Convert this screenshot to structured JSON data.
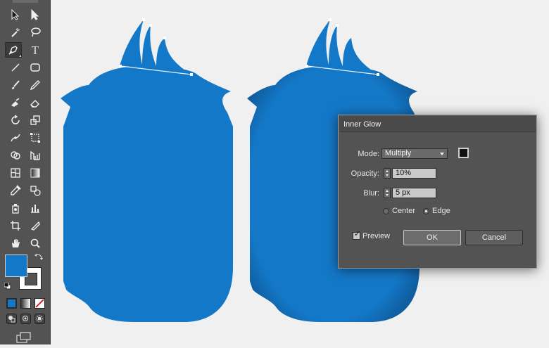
{
  "toolbar": {
    "type_tool_glyph": "T",
    "tools": [
      {
        "name": "selection-tool-icon"
      },
      {
        "name": "direct-selection-tool-icon"
      },
      {
        "name": "magic-wand-tool-icon"
      },
      {
        "name": "lasso-tool-icon"
      },
      {
        "name": "pen-tool-icon",
        "active": true
      },
      {
        "name": "type-tool-icon"
      },
      {
        "name": "line-segment-tool-icon"
      },
      {
        "name": "rounded-rectangle-tool-icon"
      },
      {
        "name": "paintbrush-tool-icon"
      },
      {
        "name": "pencil-tool-icon"
      },
      {
        "name": "blob-brush-tool-icon"
      },
      {
        "name": "eraser-tool-icon"
      },
      {
        "name": "rotate-tool-icon"
      },
      {
        "name": "scale-tool-icon"
      },
      {
        "name": "width-tool-icon"
      },
      {
        "name": "free-transform-tool-icon"
      },
      {
        "name": "shape-builder-tool-icon"
      },
      {
        "name": "perspective-grid-tool-icon"
      },
      {
        "name": "mesh-tool-icon"
      },
      {
        "name": "gradient-tool-icon"
      },
      {
        "name": "eyedropper-tool-icon"
      },
      {
        "name": "blend-tool-icon"
      },
      {
        "name": "symbol-sprayer-tool-icon"
      },
      {
        "name": "column-graph-tool-icon"
      },
      {
        "name": "artboard-tool-icon"
      },
      {
        "name": "slice-tool-icon"
      },
      {
        "name": "hand-tool-icon"
      },
      {
        "name": "zoom-tool-icon"
      }
    ],
    "fill_color": "#1478c8",
    "stroke_color": "#ffffff"
  },
  "colors": {
    "shape_fill": "#1478c8",
    "canvas_bg": "#f0f0f0",
    "panel_bg": "#535353"
  },
  "dialog": {
    "title": "Inner Glow",
    "mode_label": "Mode:",
    "mode_value": "Multiply",
    "glow_color": "#111111",
    "opacity_label": "Opacity:",
    "opacity_value": "10%",
    "blur_label": "Blur:",
    "blur_value": "5 px",
    "center_label": "Center",
    "edge_label": "Edge",
    "selected_option": "Edge",
    "preview_label": "Preview",
    "preview_checked": true,
    "ok_label": "OK",
    "cancel_label": "Cancel"
  }
}
